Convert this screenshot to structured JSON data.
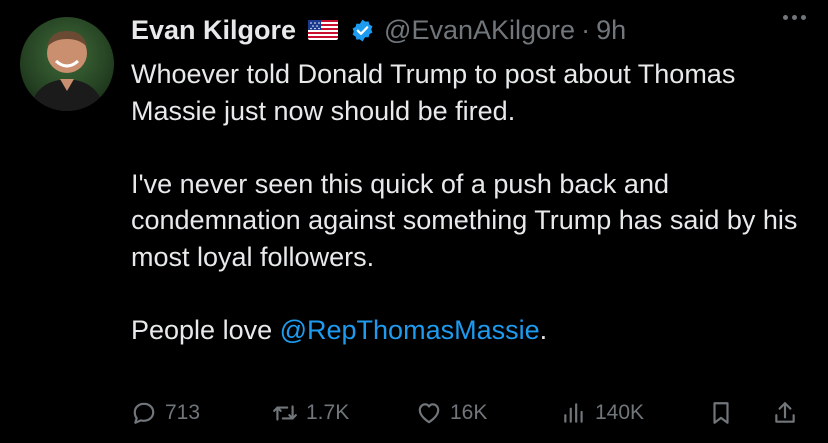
{
  "author": {
    "name": "Evan Kilgore",
    "handle": "@EvanAKilgore",
    "separator": "·",
    "time": "9h",
    "flag_icon": "us-flag-icon",
    "verified_icon": "verified-badge-icon",
    "verified_color": "#1d9bf0"
  },
  "tweet": {
    "para1": "Whoever told Donald Trump to post about Thomas Massie just now should be fired.",
    "para2": "I've never seen this quick of a push back and condemnation against something Trump has said by his most loyal followers.",
    "para3_prefix": "People love ",
    "para3_mention": "@RepThomasMassie",
    "para3_suffix": "."
  },
  "actions": {
    "replies": "713",
    "retweets": "1.7K",
    "likes": "16K",
    "views": "140K"
  },
  "colors": {
    "background": "#000000",
    "text": "#e7e9ea",
    "secondary": "#71767b",
    "accent": "#1d9bf0"
  }
}
